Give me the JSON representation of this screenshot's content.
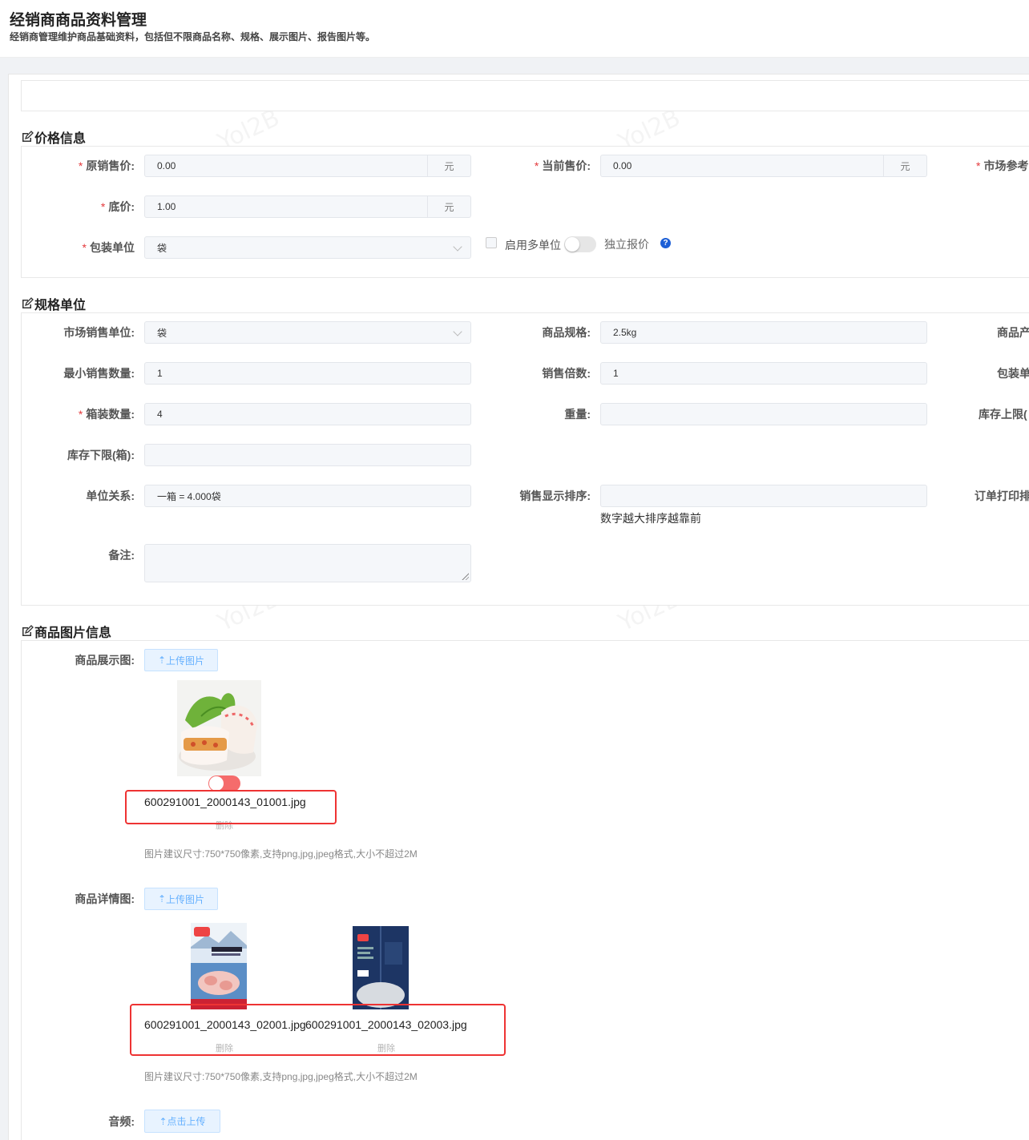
{
  "header": {
    "title": "经销商商品资料管理",
    "description": "经销商管理维护商品基础资料，包括但不限商品名称、规格、展示图片、报告图片等。"
  },
  "watermark": "Yol2B",
  "colors": {
    "required": "#e4393c",
    "accent": "#66b1ff",
    "highlight": "#e33",
    "help": "#1d5fd6"
  },
  "price": {
    "title": "价格信息",
    "original_price": {
      "label": "原销售价:",
      "value": "0.00",
      "unit": "元"
    },
    "current_price": {
      "label": "当前售价:",
      "value": "0.00",
      "unit": "元"
    },
    "market_ref": {
      "label": "市场参考"
    },
    "floor_price": {
      "label": "底价:",
      "value": "1.00",
      "unit": "元"
    },
    "pack_unit": {
      "label": "包装单位",
      "value": "袋"
    },
    "multi_unit": {
      "label": "启用多单位",
      "enabled": false
    },
    "independent_quote": {
      "label": "独立报价"
    }
  },
  "spec": {
    "title": "规格单位",
    "market_unit": {
      "label": "市场销售单位:",
      "value": "袋"
    },
    "product_spec": {
      "label": "商品规格:",
      "value": "2.5kg"
    },
    "origin": {
      "label": "商品产"
    },
    "min_qty": {
      "label": "最小销售数量:",
      "value": "1"
    },
    "multiple": {
      "label": "销售倍数:",
      "value": "1"
    },
    "pack_unit2": {
      "label": "包装单"
    },
    "box_qty": {
      "label": "箱装数量:",
      "value": "4"
    },
    "weight": {
      "label": "重量:",
      "value": ""
    },
    "stock_upper": {
      "label": "库存上限("
    },
    "stock_lower": {
      "label": "库存下限(箱):",
      "value": ""
    },
    "unit_relation": {
      "label": "单位关系:",
      "value": "一箱 = 4.000袋"
    },
    "display_order": {
      "label": "销售显示排序:",
      "value": "",
      "hint": "数字越大排序越靠前"
    },
    "print_order": {
      "label": "订单打印排"
    },
    "remark": {
      "label": "备注:",
      "value": ""
    }
  },
  "images": {
    "title": "商品图片信息",
    "display": {
      "label": "商品展示图:",
      "upload_label": "上传图片",
      "files": [
        {
          "name": "600291001_2000143_01001.jpg",
          "delete": "删除"
        }
      ],
      "tip": "图片建议尺寸:750*750像素,支持png,jpg,jpeg格式,大小不超过2M"
    },
    "detail": {
      "label": "商品详情图:",
      "upload_label": "上传图片",
      "files": [
        {
          "name": "600291001_2000143_02001.jpg",
          "delete": "删除"
        },
        {
          "name": "600291001_2000143_02003.jpg",
          "delete": "删除"
        }
      ],
      "tip": "图片建议尺寸:750*750像素,支持png,jpg,jpeg格式,大小不超过2M"
    },
    "audio": {
      "label": "音频:",
      "upload_label": "点击上传"
    }
  }
}
